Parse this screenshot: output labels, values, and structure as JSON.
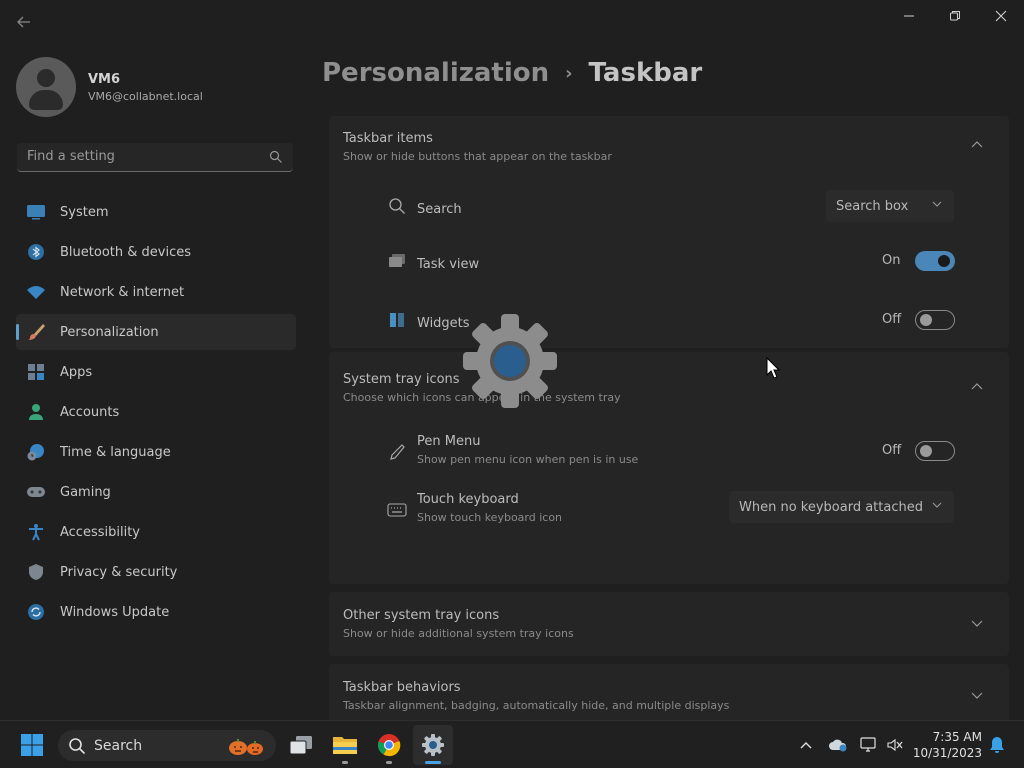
{
  "window": {
    "controls": [
      "minimize",
      "maximize",
      "close"
    ]
  },
  "profile": {
    "name": "VM6",
    "email": "VM6@collabnet.local"
  },
  "search": {
    "placeholder": "Find a setting"
  },
  "sidebar": {
    "items": [
      {
        "label": "System",
        "icon": "monitor-icon"
      },
      {
        "label": "Bluetooth & devices",
        "icon": "bluetooth-icon"
      },
      {
        "label": "Network & internet",
        "icon": "wifi-icon"
      },
      {
        "label": "Personalization",
        "icon": "brush-icon",
        "active": true
      },
      {
        "label": "Apps",
        "icon": "apps-icon"
      },
      {
        "label": "Accounts",
        "icon": "person-icon"
      },
      {
        "label": "Time & language",
        "icon": "globe-clock-icon"
      },
      {
        "label": "Gaming",
        "icon": "gamepad-icon"
      },
      {
        "label": "Accessibility",
        "icon": "accessibility-icon"
      },
      {
        "label": "Privacy & security",
        "icon": "shield-icon"
      },
      {
        "label": "Windows Update",
        "icon": "update-icon"
      }
    ]
  },
  "breadcrumb": {
    "parent": "Personalization",
    "separator": "›",
    "current": "Taskbar"
  },
  "sections": {
    "taskbar_items": {
      "title": "Taskbar items",
      "subtitle": "Show or hide buttons that appear on the taskbar",
      "search": {
        "label": "Search",
        "value": "Search box"
      },
      "task_view": {
        "label": "Task view",
        "state": "On"
      },
      "widgets": {
        "label": "Widgets",
        "state": "Off"
      }
    },
    "system_tray_icons": {
      "title": "System tray icons",
      "subtitle": "Choose which icons can appear in the system tray",
      "pen_menu": {
        "label": "Pen Menu",
        "subtitle": "Show pen menu icon when pen is in use",
        "state": "Off"
      },
      "touch_keyboard": {
        "label": "Touch keyboard",
        "subtitle": "Show touch keyboard icon",
        "value": "When no keyboard attached"
      }
    },
    "other_tray_icons": {
      "title": "Other system tray icons",
      "subtitle": "Show or hide additional system tray icons"
    },
    "taskbar_behaviors": {
      "title": "Taskbar behaviors",
      "subtitle": "Taskbar alignment, badging, automatically hide, and multiple displays"
    }
  },
  "taskbar": {
    "search_label": "Search",
    "apps": [
      "start-icon",
      "task-view-icon",
      "file-explorer-icon",
      "chrome-icon",
      "settings-icon"
    ],
    "clock": {
      "time": "7:35 AM",
      "date": "10/31/2023"
    }
  },
  "colors": {
    "accent": "#4a86b8",
    "background": "#1f1f1f",
    "card": "#252525"
  }
}
